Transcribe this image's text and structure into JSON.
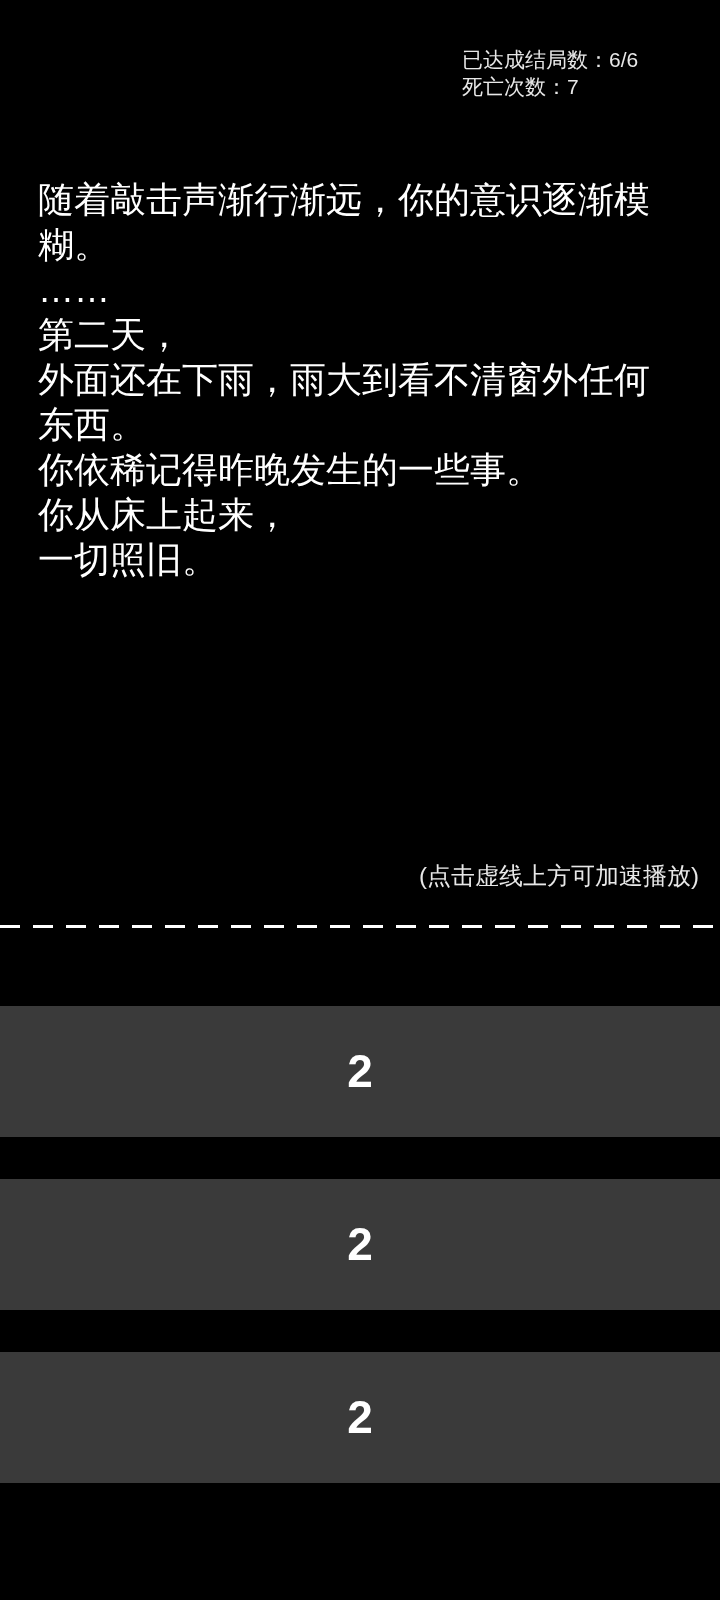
{
  "stats": [
    "已达成结局数：6/6",
    "死亡次数：7"
  ],
  "story": {
    "lines": [
      "随着敲击声渐行渐远，你的意识逐渐模糊。",
      "……",
      "第二天，",
      "外面还在下雨，雨大到看不清窗外任何东西。",
      "你依稀记得昨晚发生的一些事。",
      "你从床上起来，",
      "一切照旧。"
    ]
  },
  "hint": "(点击虚线上方可加速播放)",
  "choices": [
    {
      "label": "2"
    },
    {
      "label": "2"
    },
    {
      "label": "2"
    }
  ]
}
